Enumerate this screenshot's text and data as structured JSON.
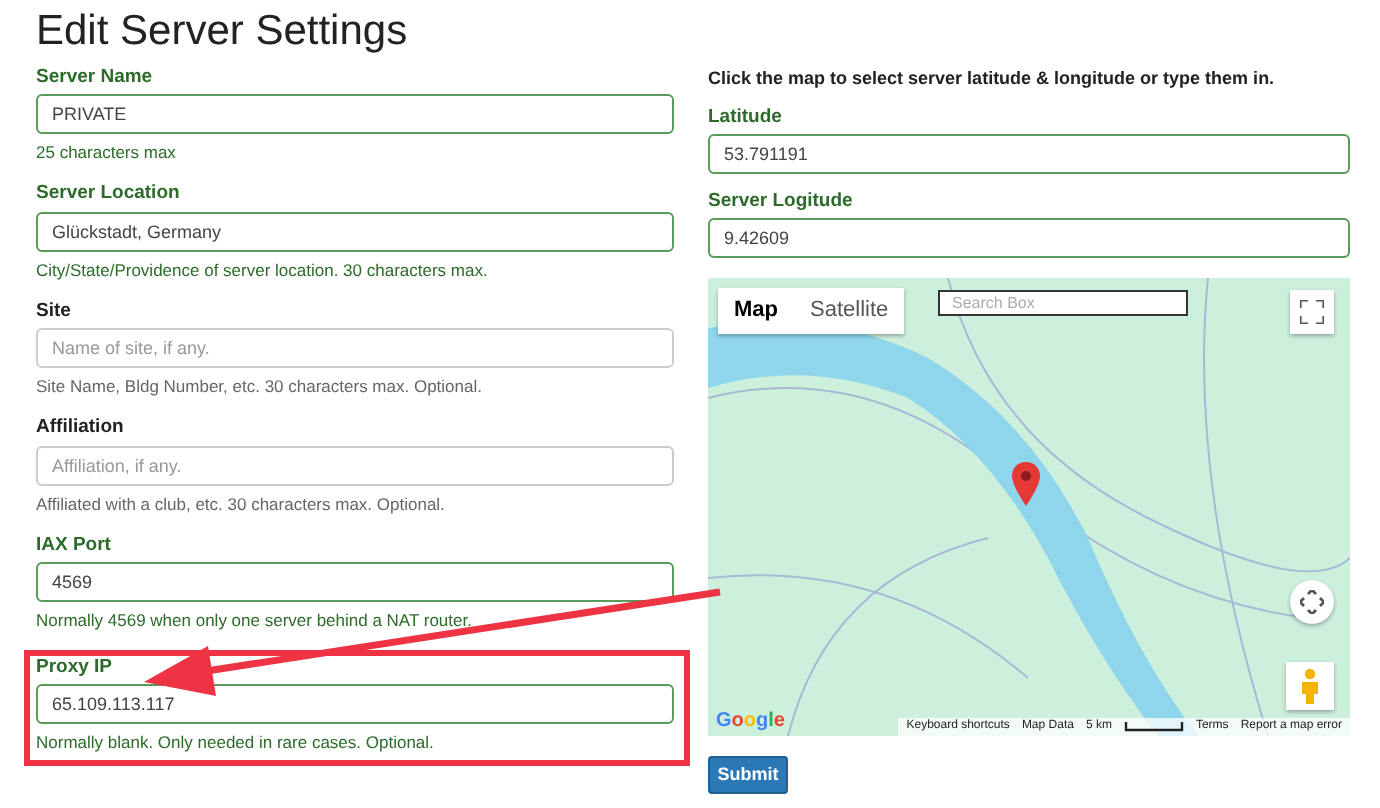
{
  "title": "Edit Server Settings",
  "fields": [
    {
      "kind": "text",
      "label": "Server Name",
      "value": "PRIVATE",
      "help": "25 characters max",
      "valid": true
    },
    {
      "kind": "text",
      "label": "Server Location",
      "value": "Glückstadt, Germany",
      "help": "City/State/Providence of server location. 30 characters max.",
      "valid": true
    },
    {
      "kind": "text",
      "label": "Site",
      "placeholder": "Name of site, if any.",
      "help": "Site Name, Bldg Number, etc. 30 characters max. Optional.",
      "valid": false
    },
    {
      "kind": "text",
      "label": "Affiliation",
      "placeholder": "Affiliation, if any.",
      "help": "Affiliated with a club, etc. 30 characters max. Optional.",
      "valid": false
    },
    {
      "kind": "number",
      "label": "IAX Port",
      "value": "4569",
      "help": "Normally 4569 when only one server behind a NAT router.",
      "valid": true
    },
    {
      "kind": "text",
      "label": "Proxy IP",
      "value": "65.109.113.117",
      "help": "Normally blank. Only needed in rare cases. Optional.",
      "valid": true,
      "highlighted": true
    }
  ],
  "instruction": "Click the map to select server latitude & longitude or type them in.",
  "coords": [
    {
      "label": "Latitude",
      "value": "53.791191",
      "valid": true
    },
    {
      "label": "Server Logitude",
      "value": "9.42609",
      "valid": true
    }
  ],
  "map": {
    "tabs": [
      {
        "label": "Map",
        "selected": true
      },
      {
        "label": "Satellite",
        "selected": false
      }
    ],
    "search": {
      "placeholder": "Search Box"
    },
    "logo": "Google",
    "footer": [
      "Keyboard shortcuts",
      "Map Data",
      "5 km",
      "Terms",
      "Report a map error"
    ]
  },
  "submit": "Submit"
}
